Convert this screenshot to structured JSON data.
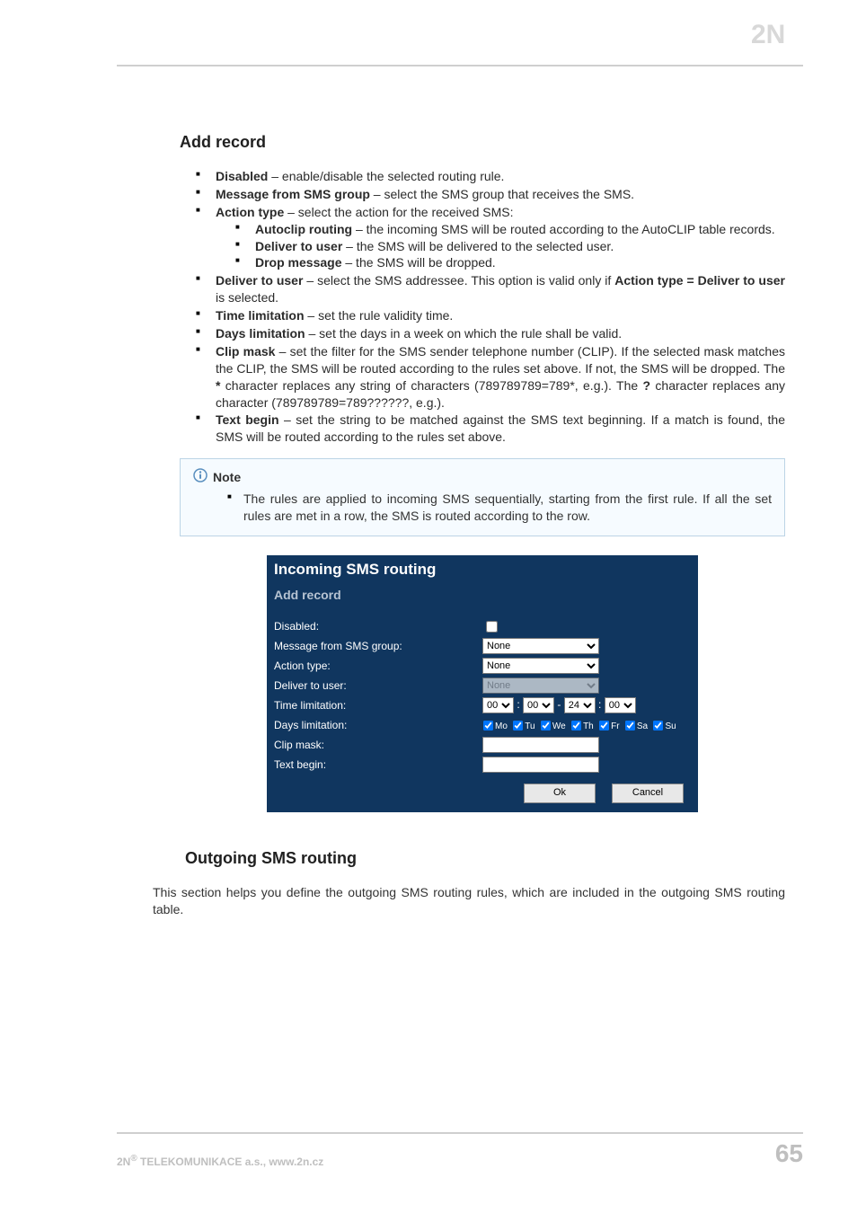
{
  "logo_text": "2N",
  "section_title": "Add record",
  "bullets": {
    "disabled_b": "Disabled",
    "disabled_t": " – enable/disable the selected routing rule.",
    "msggrp_b": "Message from SMS group",
    "msggrp_t": " – select the SMS group that receives the SMS.",
    "atype_b": "Action type",
    "atype_t": " – select the action for the received SMS:",
    "autoclip_b": "Autoclip routing",
    "autoclip_t": " – the incoming SMS will be routed according to the AutoCLIP table records.",
    "del2user_sub_b": "Deliver to user",
    "del2user_sub_t": " – the SMS will be delivered to the selected user.",
    "dropmsg_b": "Drop message",
    "dropmsg_t": " – the SMS will be dropped.",
    "del2user_b": "Deliver to user",
    "del2user_t1": " – select the SMS addressee. This option is valid only if ",
    "del2user_b2": "Action type = Deliver to user",
    "del2user_t2": " is selected.",
    "timelim_b": "Time limitation",
    "timelim_t": " – set the rule validity time.",
    "dayslim_b": "Days limitation",
    "dayslim_t": " – set the days in a week on which the rule shall be valid.",
    "clipmask_b": "Clip mask",
    "clipmask_t1": " – set the filter for the SMS sender telephone number (CLIP). If the selected mask matches the CLIP, the SMS will be routed according to the rules set above. If not, the SMS will be dropped. The ",
    "clipmask_star": "*",
    "clipmask_t2": " character replaces any string of characters (789789789=789*, e.g.). The ",
    "clipmask_q": "?",
    "clipmask_t3": " character replaces any character (789789789=789??????, e.g.).",
    "textbegin_b": "Text begin",
    "textbegin_t": " – set the string to be matched against the SMS text beginning. If a match is found, the SMS will be routed according to the rules set above."
  },
  "note": {
    "title": "Note",
    "text": "The rules are applied to incoming SMS sequentially, starting from the first rule. If all the set rules are met in a row, the SMS is routed according to the row."
  },
  "form": {
    "title": "Incoming SMS routing",
    "subtitle": "Add record",
    "labels": {
      "disabled": "Disabled:",
      "msggrp": "Message from SMS group:",
      "atype": "Action type:",
      "deliver": "Deliver to user:",
      "timelim": "Time limitation:",
      "dayslim": "Days limitation:",
      "clipmask": "Clip mask:",
      "textbegin": "Text begin:"
    },
    "values": {
      "msggrp": "None",
      "atype": "None",
      "deliver": "None",
      "time_h1": "00",
      "time_m1": "00",
      "time_h2": "24",
      "time_m2": "00"
    },
    "days": [
      "Mo",
      "Tu",
      "We",
      "Th",
      "Fr",
      "Sa",
      "Su"
    ],
    "buttons": {
      "ok": "Ok",
      "cancel": "Cancel"
    }
  },
  "outgoing": {
    "title": "Outgoing SMS routing",
    "text": "This section helps you define the outgoing SMS routing rules, which are included in the outgoing SMS routing table."
  },
  "footer": {
    "left_prefix": "2N",
    "left_rest": " TELEKOMUNIKACE a.s., www.2n.cz",
    "page": "65"
  }
}
